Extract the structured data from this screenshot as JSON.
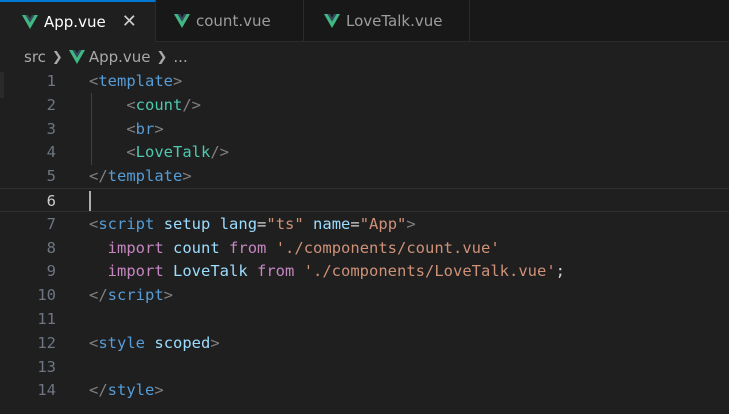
{
  "tabs": [
    {
      "label": "App.vue",
      "active": true
    },
    {
      "label": "count.vue",
      "active": false
    },
    {
      "label": "LoveTalk.vue",
      "active": false
    }
  ],
  "breadcrumb": {
    "folder": "src",
    "file": "App.vue",
    "more": "..."
  },
  "icons": {
    "vue": "vue-logo-icon",
    "close": "close-icon",
    "chevron": "chevron-right-icon"
  },
  "colors": {
    "vue": "#41b883",
    "accent": "#0078d4",
    "tag": "#569cd6",
    "component": "#4ec9b0",
    "attribute": "#9cdcfe",
    "string": "#ce9178",
    "keyword": "#c586c0"
  },
  "editor": {
    "current_line": 6,
    "lines": [
      {
        "n": "1",
        "tokens": [
          [
            "<",
            "t-bracket"
          ],
          [
            "template",
            "t-tag"
          ],
          [
            ">",
            "t-bracket"
          ]
        ]
      },
      {
        "n": "2",
        "tokens": [
          [
            "    ",
            ""
          ],
          [
            "<",
            "t-bracket"
          ],
          [
            "count",
            "t-comp"
          ],
          [
            "/>",
            "t-bracket"
          ]
        ]
      },
      {
        "n": "3",
        "tokens": [
          [
            "    ",
            ""
          ],
          [
            "<",
            "t-bracket"
          ],
          [
            "br",
            "t-tag"
          ],
          [
            ">",
            "t-bracket"
          ]
        ]
      },
      {
        "n": "4",
        "tokens": [
          [
            "    ",
            ""
          ],
          [
            "<",
            "t-bracket"
          ],
          [
            "LoveTalk",
            "t-comp"
          ],
          [
            "/>",
            "t-bracket"
          ]
        ]
      },
      {
        "n": "5",
        "tokens": [
          [
            "</",
            "t-bracket"
          ],
          [
            "template",
            "t-tag"
          ],
          [
            ">",
            "t-bracket"
          ]
        ]
      },
      {
        "n": "6",
        "tokens": []
      },
      {
        "n": "7",
        "tokens": [
          [
            "<",
            "t-bracket"
          ],
          [
            "script",
            "t-tag"
          ],
          [
            " ",
            ""
          ],
          [
            "setup",
            "t-attr"
          ],
          [
            " ",
            ""
          ],
          [
            "lang",
            "t-attr"
          ],
          [
            "=",
            "t-eq"
          ],
          [
            "\"ts\"",
            "t-str"
          ],
          [
            " ",
            ""
          ],
          [
            "name",
            "t-attr"
          ],
          [
            "=",
            "t-eq"
          ],
          [
            "\"App\"",
            "t-str"
          ],
          [
            ">",
            "t-bracket"
          ]
        ]
      },
      {
        "n": "8",
        "tokens": [
          [
            "  ",
            ""
          ],
          [
            "import",
            "t-kw"
          ],
          [
            " ",
            ""
          ],
          [
            "count",
            "t-id"
          ],
          [
            " ",
            ""
          ],
          [
            "from",
            "t-kw"
          ],
          [
            " ",
            ""
          ],
          [
            "'./components/count.vue'",
            "t-str"
          ]
        ]
      },
      {
        "n": "9",
        "tokens": [
          [
            "  ",
            ""
          ],
          [
            "import",
            "t-kw"
          ],
          [
            " ",
            ""
          ],
          [
            "LoveTalk",
            "t-id"
          ],
          [
            " ",
            ""
          ],
          [
            "from",
            "t-kw"
          ],
          [
            " ",
            ""
          ],
          [
            "'./components/LoveTalk.vue'",
            "t-str"
          ],
          [
            ";",
            "t-eq"
          ]
        ]
      },
      {
        "n": "10",
        "tokens": [
          [
            "</",
            "t-bracket"
          ],
          [
            "script",
            "t-tag"
          ],
          [
            ">",
            "t-bracket"
          ]
        ]
      },
      {
        "n": "11",
        "tokens": []
      },
      {
        "n": "12",
        "tokens": [
          [
            "<",
            "t-bracket"
          ],
          [
            "style",
            "t-tag"
          ],
          [
            " ",
            ""
          ],
          [
            "scoped",
            "t-attr"
          ],
          [
            ">",
            "t-bracket"
          ]
        ]
      },
      {
        "n": "13",
        "tokens": []
      },
      {
        "n": "14",
        "tokens": [
          [
            "</",
            "t-bracket"
          ],
          [
            "style",
            "t-tag"
          ],
          [
            ">",
            "t-bracket"
          ]
        ]
      }
    ]
  }
}
